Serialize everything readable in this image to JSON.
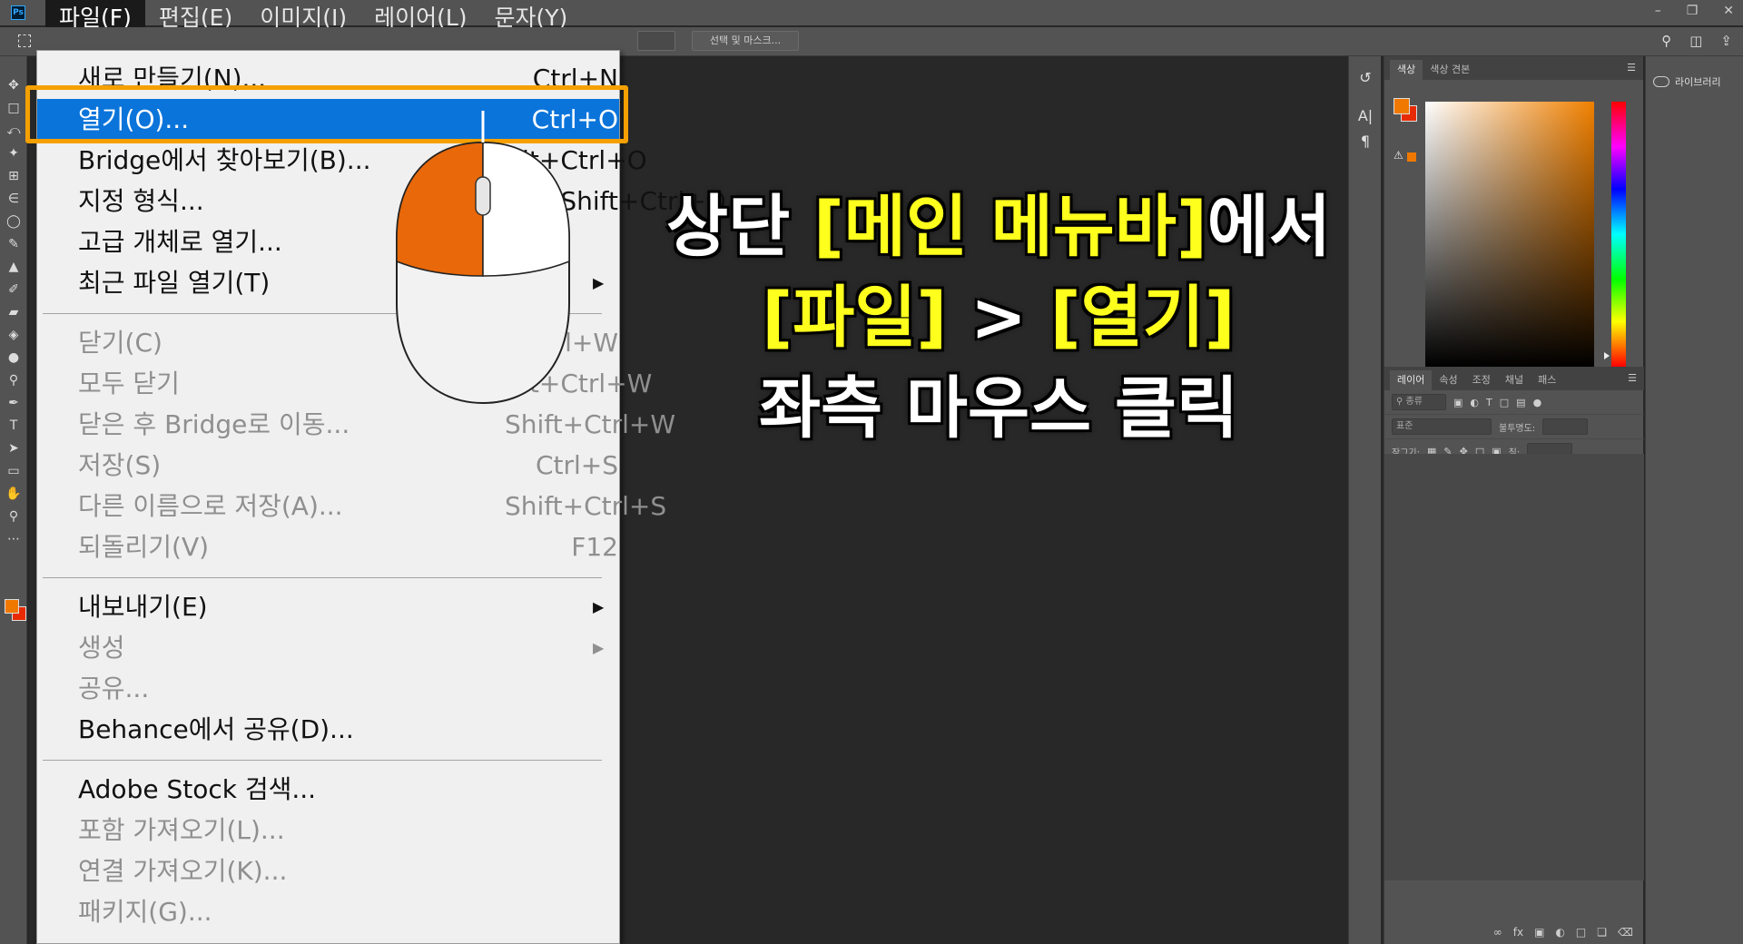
{
  "app": {
    "logo_text": "Ps"
  },
  "menubar": {
    "items": [
      "파일(F)",
      "편집(E)",
      "이미지(I)",
      "레이어(L)",
      "문자(Y)"
    ],
    "active_index": 0
  },
  "options_bar": {
    "mask_button": "선택 및 마스크..."
  },
  "file_menu": {
    "groups": [
      [
        {
          "label": "새로 만들기(N)...",
          "shortcut": "Ctrl+N",
          "enabled": true
        },
        {
          "label": "열기(O)...",
          "shortcut": "Ctrl+O",
          "enabled": true,
          "selected": true
        },
        {
          "label": "Bridge에서 찾아보기(B)...",
          "shortcut": "Alt+Ctrl+O",
          "enabled": true
        },
        {
          "label": "지정 형식...",
          "shortcut": "Alt+Shift+Ctrl+O",
          "enabled": true
        },
        {
          "label": "고급 개체로 열기...",
          "shortcut": "",
          "enabled": true
        },
        {
          "label": "최근 파일 열기(T)",
          "shortcut": "",
          "enabled": true,
          "submenu": true
        }
      ],
      [
        {
          "label": "닫기(C)",
          "shortcut": "Ctrl+W",
          "enabled": false
        },
        {
          "label": "모두 닫기",
          "shortcut": "Alt+Ctrl+W",
          "enabled": false
        },
        {
          "label": "닫은 후 Bridge로 이동...",
          "shortcut": "Shift+Ctrl+W",
          "enabled": false
        },
        {
          "label": "저장(S)",
          "shortcut": "Ctrl+S",
          "enabled": false
        },
        {
          "label": "다른 이름으로 저장(A)...",
          "shortcut": "Shift+Ctrl+S",
          "enabled": false
        },
        {
          "label": "되돌리기(V)",
          "shortcut": "F12",
          "enabled": false
        }
      ],
      [
        {
          "label": "내보내기(E)",
          "shortcut": "",
          "enabled": true,
          "submenu": true
        },
        {
          "label": "생성",
          "shortcut": "",
          "enabled": false,
          "submenu": true
        },
        {
          "label": "공유...",
          "shortcut": "",
          "enabled": false
        },
        {
          "label": "Behance에서 공유(D)...",
          "shortcut": "",
          "enabled": true
        }
      ],
      [
        {
          "label": "Adobe Stock 검색...",
          "shortcut": "",
          "enabled": true
        },
        {
          "label": "포함 가져오기(L)...",
          "shortcut": "",
          "enabled": false
        },
        {
          "label": "연결 가져오기(K)...",
          "shortcut": "",
          "enabled": false
        },
        {
          "label": "패키지(G)...",
          "shortcut": "",
          "enabled": false
        }
      ]
    ]
  },
  "caption": {
    "line1": {
      "pre": "상단 ",
      "highlight": "[메인 메뉴바]",
      "post": "에서"
    },
    "line2": {
      "part1": "[파일]",
      "arrow": " > ",
      "part2": "[열기]"
    },
    "line3": "좌측 마우스 클릭"
  },
  "color_panel": {
    "tabs": [
      "색상",
      "색상 견본"
    ],
    "active_tab": 0,
    "fg_color": "#f07800",
    "bg_color": "#e82a00"
  },
  "layers_panel": {
    "tabs": [
      "레이어",
      "속성",
      "조정",
      "채널",
      "패스"
    ],
    "active_tab": 0,
    "filter_label": "종류",
    "blend_mode": "표준",
    "opacity_label": "불투명도:",
    "lock_label": "잠그기:",
    "fill_label": "칠:"
  },
  "libraries_panel": {
    "label": "라이브러리"
  },
  "colors": {
    "accent_orange": "#f5a000",
    "menu_selected": "#0a74da",
    "caption_yellow": "#ffff1e"
  }
}
